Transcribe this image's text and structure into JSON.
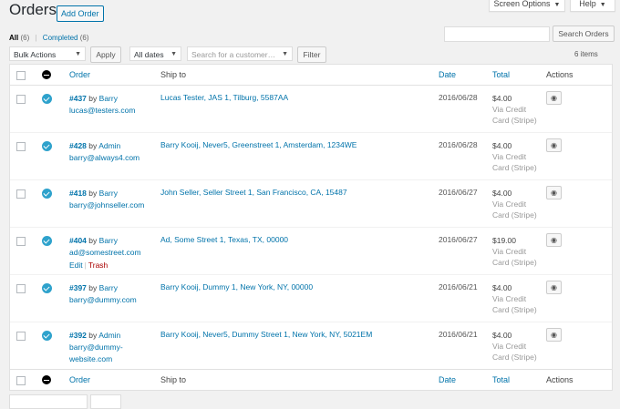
{
  "page": {
    "title": "Orders",
    "add_button": "Add Order",
    "screen_options": "Screen Options",
    "help": "Help"
  },
  "filters": {
    "all_label": "All",
    "all_count": "(6)",
    "completed_label": "Completed",
    "completed_count": "(6)"
  },
  "search": {
    "button": "Search Orders",
    "value": ""
  },
  "toolbar": {
    "bulk_actions": "Bulk Actions",
    "apply": "Apply",
    "dates": "All dates",
    "customer_placeholder": "Search for a customer…",
    "filter": "Filter",
    "items_count": "6 items"
  },
  "columns": {
    "order": "Order",
    "ship_to": "Ship to",
    "date": "Date",
    "total": "Total",
    "actions": "Actions"
  },
  "orders": [
    {
      "number": "#437",
      "by": "by",
      "customer": "Barry",
      "email": "lucas@testers.com",
      "ship_to": "Lucas Tester, JAS 1, Tilburg, 5587AA",
      "date": "2016/06/28",
      "total": "$4.00",
      "via": "Via Credit Card (Stripe)",
      "status": "completed"
    },
    {
      "number": "#428",
      "by": "by",
      "customer": "Admin",
      "email": "barry@always4.com",
      "ship_to": "Barry Kooij, Never5, Greenstreet 1, Amsterdam, 1234WE",
      "date": "2016/06/28",
      "total": "$4.00",
      "via": "Via Credit Card (Stripe)",
      "status": "completed"
    },
    {
      "number": "#418",
      "by": "by",
      "customer": "Barry",
      "email": "barry@johnseller.com",
      "ship_to": "John Seller, Seller Street 1, San Francisco, CA, 15487",
      "date": "2016/06/27",
      "total": "$4.00",
      "via": "Via Credit Card (Stripe)",
      "status": "completed"
    },
    {
      "number": "#404",
      "by": "by",
      "customer": "Barry",
      "email": "ad@somestreet.com",
      "ship_to": "Ad, Some Street 1, Texas, TX, 00000",
      "date": "2016/06/27",
      "total": "$19.00",
      "via": "Via Credit Card (Stripe)",
      "status": "completed",
      "row_actions": {
        "edit": "Edit",
        "trash": "Trash"
      }
    },
    {
      "number": "#397",
      "by": "by",
      "customer": "Barry",
      "email": "barry@dummy.com",
      "ship_to": "Barry Kooij, Dummy 1, New York, NY, 00000",
      "date": "2016/06/21",
      "total": "$4.00",
      "via": "Via Credit Card (Stripe)",
      "status": "completed"
    },
    {
      "number": "#392",
      "by": "by",
      "customer": "Admin",
      "email": "barry@dummy-website.com",
      "ship_to": "Barry Kooij, Never5, Dummy Street 1, New York, NY, 5021EM",
      "date": "2016/06/21",
      "total": "$4.00",
      "via": "Via Credit Card (Stripe)",
      "status": "completed"
    }
  ],
  "icons": {
    "status": "check-circle-icon",
    "view": "eye-icon",
    "header_status": "minus-circle-icon",
    "caret": "caret-down-icon"
  },
  "colors": {
    "accent": "#0073aa",
    "status_completed": "#2ea2cc",
    "trash": "#aa0000"
  }
}
